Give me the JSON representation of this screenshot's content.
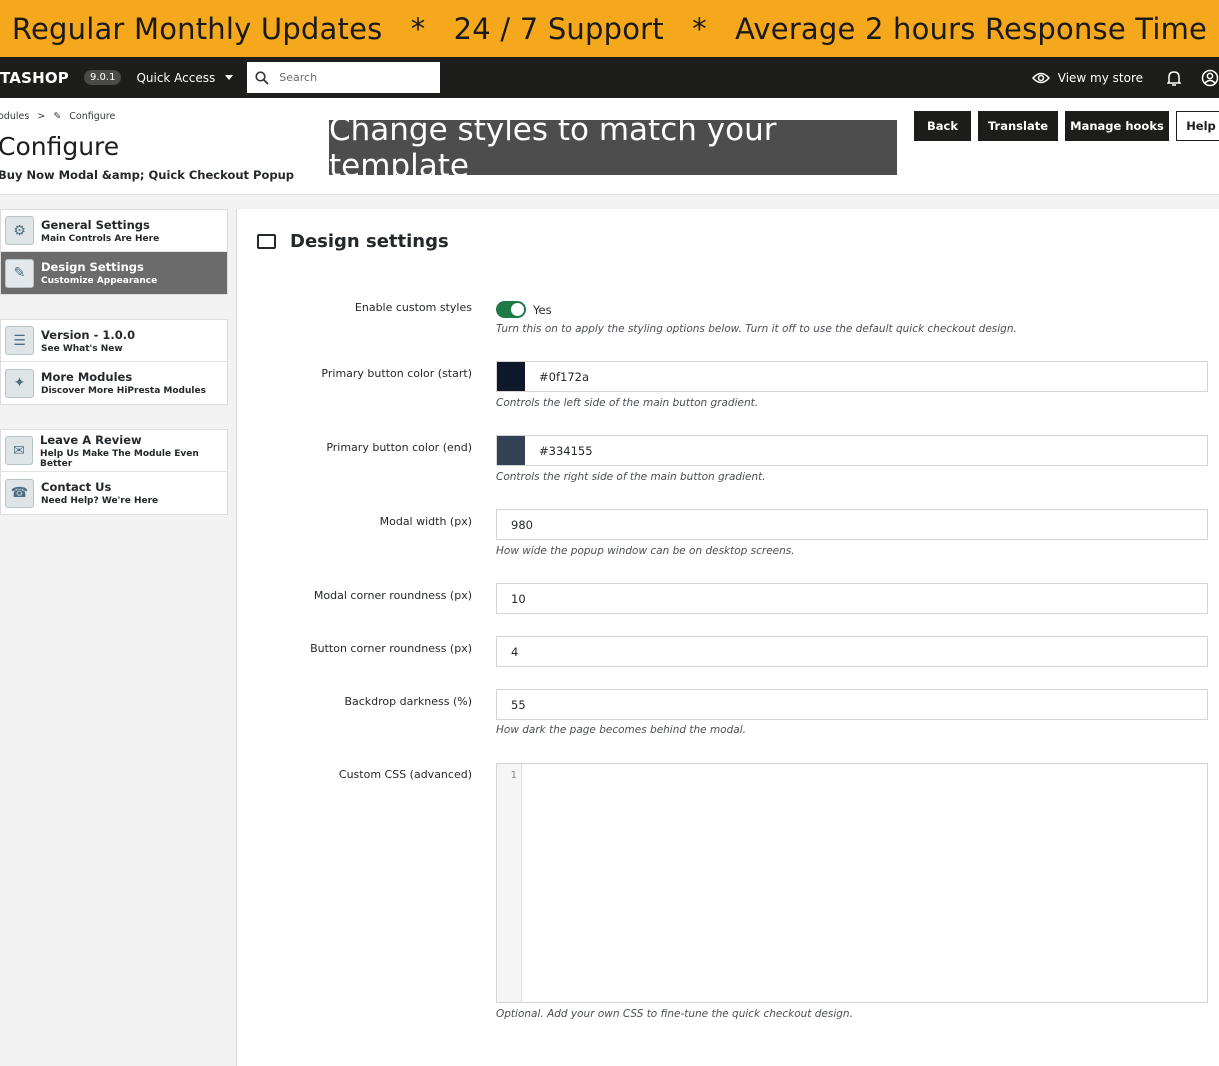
{
  "promo_banner": "Regular Monthly Updates   *   24 / 7 Support   *   Average 2 hours Response Time",
  "topbar": {
    "logo": "TASHOP",
    "version": "9.0.1",
    "quick_access": "Quick Access",
    "search_placeholder": "Search",
    "view_store": "View my store"
  },
  "header": {
    "breadcrumb_parent": "odules",
    "breadcrumb_sep": ">",
    "breadcrumb_current": "Configure",
    "title": "Configure",
    "subtitle": "Buy Now Modal &amp; Quick Checkout Popup"
  },
  "overlay_banner": "Change styles to match your template",
  "actions": {
    "back": "Back",
    "translate": "Translate",
    "manage_hooks": "Manage hooks",
    "help": "Help"
  },
  "sidebar": {
    "groups": [
      [
        {
          "title": "General Settings",
          "subtitle": "Main Controls Are Here",
          "icon": "settings-icon"
        },
        {
          "title": "Design Settings",
          "subtitle": "Customize Appearance",
          "icon": "design-icon"
        }
      ],
      [
        {
          "title": "Version - 1.0.0",
          "subtitle": "See What's New",
          "icon": "document-icon"
        },
        {
          "title": "More Modules",
          "subtitle": "Discover More HiPresta Modules",
          "icon": "modules-icon"
        }
      ],
      [
        {
          "title": "Leave A Review",
          "subtitle": "Help Us Make The Module Even Better",
          "icon": "review-icon"
        },
        {
          "title": "Contact Us",
          "subtitle": "Need Help? We're Here",
          "icon": "support-icon"
        }
      ]
    ]
  },
  "panel": {
    "title": "Design settings",
    "enable_label": "Enable custom styles",
    "enable_value": "Yes",
    "enable_help": "Turn this on to apply the styling options below. Turn it off to use the default quick checkout design.",
    "primary_start_label": "Primary button color (start)",
    "primary_start_value": "#0f172a",
    "primary_start_color": "#0f172a",
    "primary_start_help": "Controls the left side of the main button gradient.",
    "primary_end_label": "Primary button color (end)",
    "primary_end_value": "#334155",
    "primary_end_color": "#334155",
    "primary_end_help": "Controls the right side of the main button gradient.",
    "modal_width_label": "Modal width (px)",
    "modal_width_value": "980",
    "modal_width_help": "How wide the popup window can be on desktop screens.",
    "modal_corner_label": "Modal corner roundness (px)",
    "modal_corner_value": "10",
    "button_corner_label": "Button corner roundness (px)",
    "button_corner_value": "4",
    "backdrop_label": "Backdrop darkness (%)",
    "backdrop_value": "55",
    "backdrop_help": "How dark the page becomes behind the modal.",
    "css_label": "Custom CSS (advanced)",
    "css_line": "1",
    "css_help": "Optional. Add your own CSS to fine-tune the quick checkout design."
  }
}
